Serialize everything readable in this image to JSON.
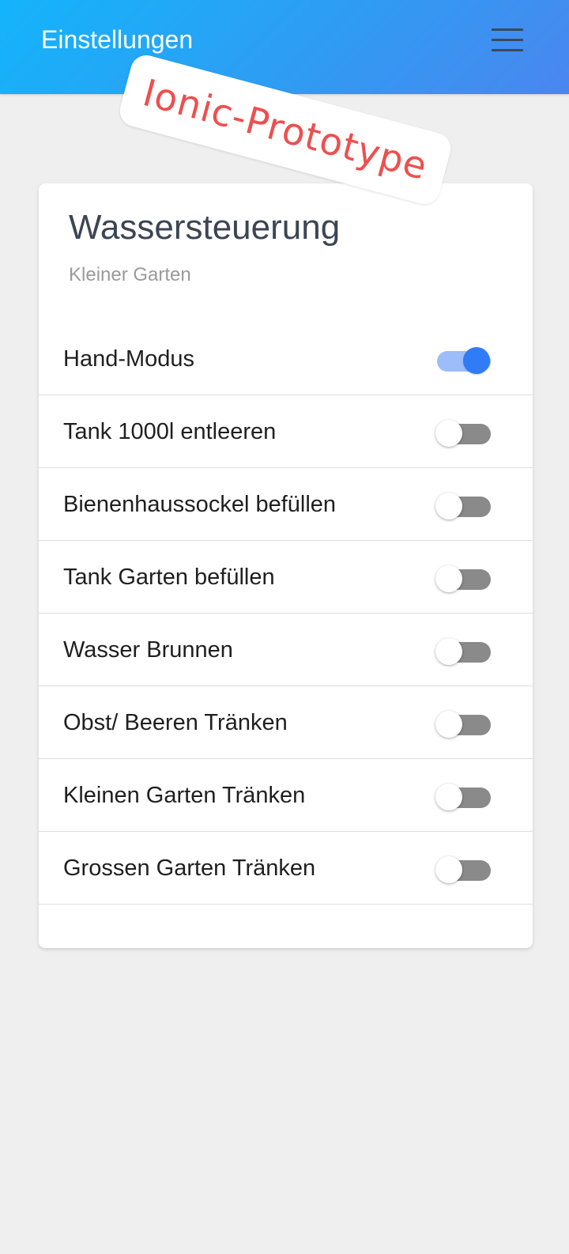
{
  "toolbar": {
    "title": "Einstellungen",
    "menu_icon": "menu-icon"
  },
  "overlay": {
    "text": "Ionic-Prototype",
    "color": "#ee4f4f"
  },
  "card": {
    "title": "Wassersteuerung",
    "subtitle": "Kleiner Garten"
  },
  "items": [
    {
      "label": "Hand-Modus",
      "on": true
    },
    {
      "label": "Tank 1000l entleeren",
      "on": false
    },
    {
      "label": "Bienenhaussockel befüllen",
      "on": false
    },
    {
      "label": "Tank Garten befüllen",
      "on": false
    },
    {
      "label": "Wasser Brunnen",
      "on": false
    },
    {
      "label": "Obst/ Beeren Tränken",
      "on": false
    },
    {
      "label": "Kleinen Garten Tränken",
      "on": false
    },
    {
      "label": "Grossen Garten Tränken",
      "on": false
    }
  ],
  "colors": {
    "accent": "#2f7cf6",
    "toolbar_start": "#14b4fb",
    "toolbar_end": "#4a86ef",
    "background": "#efefef"
  }
}
